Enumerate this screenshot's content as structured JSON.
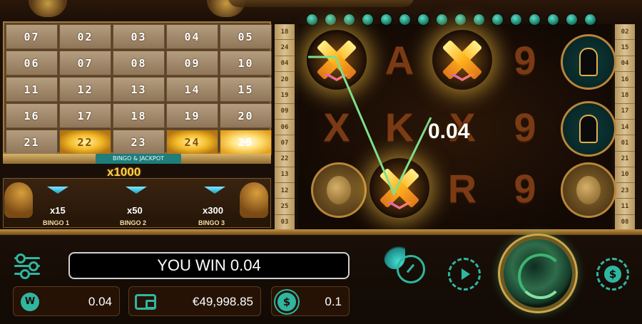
{
  "bingo": {
    "cells": [
      "07",
      "02",
      "03",
      "04",
      "05",
      "06",
      "07",
      "08",
      "09",
      "10",
      "11",
      "12",
      "13",
      "14",
      "15",
      "16",
      "17",
      "18",
      "19",
      "20",
      "21",
      "22",
      "23",
      "24",
      "25"
    ],
    "jackpot_label": "BINGO & JACKPOT",
    "jackpot_multiplier": "x1000",
    "prizes": [
      {
        "multiplier": "x15",
        "label": "BINGO 1"
      },
      {
        "multiplier": "x50",
        "label": "BINGO 2"
      },
      {
        "multiplier": "x300",
        "label": "BINGO 3"
      }
    ]
  },
  "left_numbers": [
    "18",
    "24",
    "04",
    "20",
    "19",
    "09",
    "06",
    "07",
    "22",
    "13",
    "12",
    "25",
    "03"
  ],
  "right_numbers": [
    "02",
    "15",
    "04",
    "16",
    "18",
    "17",
    "14",
    "01",
    "21",
    "10",
    "23",
    "11",
    "08"
  ],
  "reels": {
    "win_amount": "0.04",
    "symbols": [
      "rune-x-win",
      "A",
      "rune-x-win",
      "9",
      "anubis",
      "X",
      "K",
      "X",
      "9",
      "anubis",
      "gold-face",
      "rune-x-win",
      "R",
      "9",
      "gold-face"
    ]
  },
  "bottom": {
    "win_message": "YOU WIN 0.04",
    "win_value": "0.04",
    "balance": "€49,998.85",
    "bet": "0.1",
    "win_icon_text": "W",
    "coin_symbol": "$"
  },
  "colors": {
    "accent": "#2fb6a0",
    "gold": "#ffd24a",
    "win_line": "#7ee08a"
  }
}
